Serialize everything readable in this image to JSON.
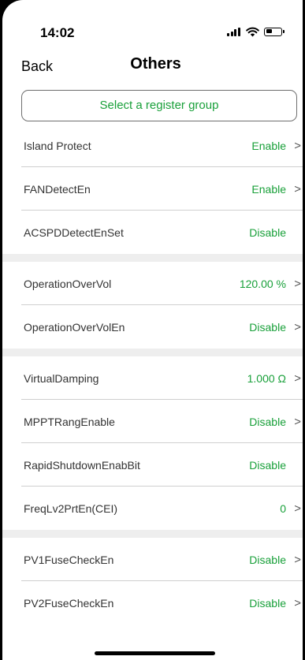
{
  "status_bar": {
    "time": "14:02",
    "icons": [
      "signal-icon",
      "wifi-icon",
      "battery-icon"
    ]
  },
  "nav": {
    "back_label": "Back",
    "title": "Others"
  },
  "register_select": {
    "label": "Select a register group"
  },
  "rows": [
    {
      "label": "Island Protect",
      "value": "Enable",
      "chevron": ">"
    },
    {
      "label": "FANDetectEn",
      "value": "Enable",
      "chevron": ">"
    },
    {
      "label": "ACSPDDetectEnSet",
      "value": "Disable",
      "chevron": ""
    },
    {
      "label": "OperationOverVol",
      "value": "120.00 %",
      "chevron": ">"
    },
    {
      "label": "OperationOverVolEn",
      "value": "Disable",
      "chevron": ">"
    },
    {
      "label": "VirtualDamping",
      "value": "1.000 Ω",
      "chevron": ">"
    },
    {
      "label": "MPPTRangEnable",
      "value": "Disable",
      "chevron": ">"
    },
    {
      "label": "RapidShutdownEnabBit",
      "value": "Disable",
      "chevron": ""
    },
    {
      "label": "FreqLv2PrtEn(CEI)",
      "value": "0",
      "chevron": ">"
    },
    {
      "label": "PV1FuseCheckEn",
      "value": "Disable",
      "chevron": ">"
    },
    {
      "label": "PV2FuseCheckEn",
      "value": "Disable",
      "chevron": ">"
    }
  ],
  "colors": {
    "accent_green": "#19a03a",
    "section_gap": "#eeeeee",
    "divider": "#cfcfcf"
  }
}
